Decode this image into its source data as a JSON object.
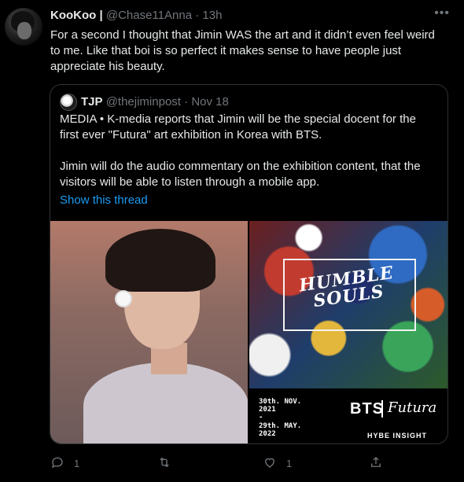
{
  "tweet": {
    "author_name": "KooKoo |",
    "author_handle": "@Chase11Anna",
    "separator": "·",
    "time": "13h",
    "more_icon": "more-horizontal-icon",
    "text": "For a second I thought that Jimin WAS the art and it didn’t even feel weird to me. Like that boi is so perfect it makes sense to have people just appreciate his beauty."
  },
  "quoted": {
    "author_name": "TJP",
    "author_handle": "@thejiminpost",
    "separator": "·",
    "date": "Nov 18",
    "para1": "MEDIA • K-media reports that Jimin will be the special docent for the first ever \"Futura\" art exhibition in Korea with BTS.",
    "para2": "Jimin will do the audio commentary on the exhibition content, that the visitors will be able to listen through a mobile app.",
    "show_thread": "Show this thread",
    "poster": {
      "title_line1": "HUMBLE",
      "title_line2": "SOULS",
      "date_start_line1": "30th. NOV.",
      "date_start_line2": "2021",
      "date_dash": "-",
      "date_end_line1": "29th. MAY.",
      "date_end_line2": "2022",
      "brand": "BTS",
      "signature": "Futura",
      "footer": "HYBE INSIGHT"
    }
  },
  "actions": {
    "reply_count": "1",
    "retweet_count": "",
    "like_count": "1"
  },
  "colors": {
    "background": "#000000",
    "text": "#e7e9ea",
    "muted": "#71767b",
    "link": "#1d9bf0",
    "border": "#2f3336"
  }
}
